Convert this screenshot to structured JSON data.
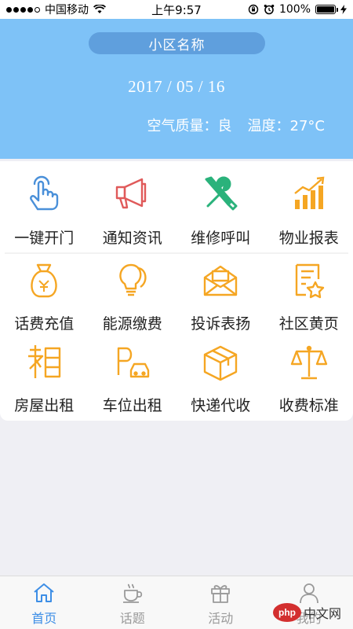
{
  "status_bar": {
    "carrier": "中国移动",
    "time": "上午9:57",
    "battery": "100%"
  },
  "header": {
    "community_name": "小区名称",
    "date": "2017 / 05 / 16",
    "air_quality": "空气质量：良",
    "temperature": "温度：27°C"
  },
  "grid": {
    "row1": [
      {
        "label": "一键开门",
        "icon": "tap-finger-icon"
      },
      {
        "label": "通知资讯",
        "icon": "megaphone-icon"
      },
      {
        "label": "维修呼叫",
        "icon": "tools-icon"
      },
      {
        "label": "物业报表",
        "icon": "bar-chart-icon"
      }
    ],
    "row2": [
      {
        "label": "话费充值",
        "icon": "money-bag-icon"
      },
      {
        "label": "能源缴费",
        "icon": "light-bulb-icon"
      },
      {
        "label": "投诉表扬",
        "icon": "envelope-icon"
      },
      {
        "label": "社区黄页",
        "icon": "document-star-icon"
      }
    ],
    "row3": [
      {
        "label": "房屋出租",
        "icon": "house-rent-icon"
      },
      {
        "label": "车位出租",
        "icon": "parking-icon"
      },
      {
        "label": "快递代收",
        "icon": "package-icon"
      },
      {
        "label": "收费标准",
        "icon": "scale-icon"
      }
    ]
  },
  "tabs": [
    {
      "label": "首页",
      "icon": "home-icon",
      "active": true
    },
    {
      "label": "话题",
      "icon": "coffee-cup-icon",
      "active": false
    },
    {
      "label": "活动",
      "icon": "gift-icon",
      "active": false
    },
    {
      "label": "我的",
      "icon": "user-icon",
      "active": false
    }
  ],
  "watermark": {
    "logo": "php",
    "text": "中文网"
  },
  "colors": {
    "header_bg": "#7ec2f7",
    "pill_bg": "#5f9fdd",
    "accent_blue": "#3d8ee6",
    "icon_blue": "#4a90d9",
    "icon_red": "#e05a5a",
    "icon_green": "#2ab27b",
    "icon_orange": "#f5a623"
  }
}
